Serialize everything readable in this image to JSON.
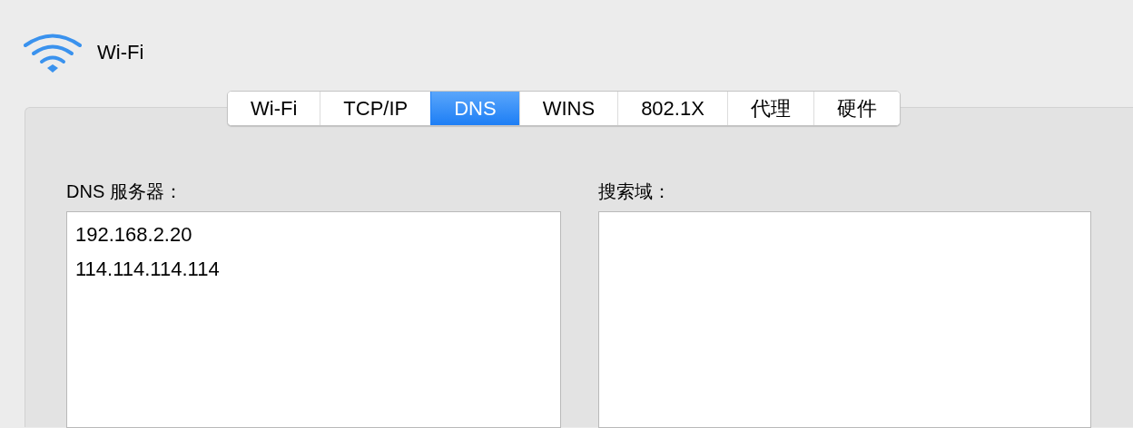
{
  "window": {
    "title": "Wi-Fi"
  },
  "tabs": [
    {
      "label": "Wi-Fi",
      "selected": false
    },
    {
      "label": "TCP/IP",
      "selected": false
    },
    {
      "label": "DNS",
      "selected": true
    },
    {
      "label": "WINS",
      "selected": false
    },
    {
      "label": "802.1X",
      "selected": false
    },
    {
      "label": "代理",
      "selected": false
    },
    {
      "label": "硬件",
      "selected": false
    }
  ],
  "dns_servers": {
    "label": "DNS 服务器：",
    "entries": [
      "192.168.2.20",
      "114.114.114.114"
    ]
  },
  "search_domains": {
    "label": "搜索域："
  }
}
